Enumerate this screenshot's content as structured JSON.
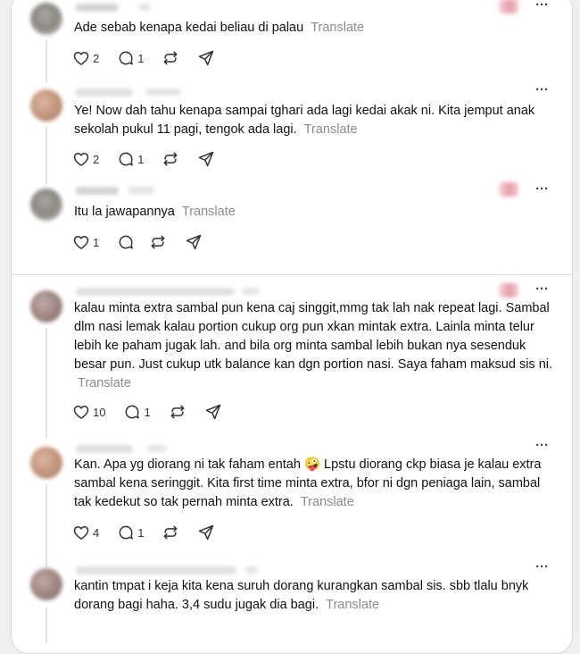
{
  "replies": [
    {
      "text": "Ade sebab kenapa kedai beliau di palau",
      "translate_label": "Translate",
      "likes": "2",
      "comments": "1"
    },
    {
      "text": "Ye! Now dah tahu kenapa sampai tghari ada lagi kedai akak ni. Kita jemput anak sekolah pukul 11 pagi, tengok ada lagi.",
      "translate_label": "Translate",
      "likes": "2",
      "comments": "1"
    },
    {
      "text": "Itu la jawapannya",
      "translate_label": "Translate",
      "likes": "1",
      "comments": ""
    },
    {
      "text": "kalau minta extra sambal pun kena caj singgit,mmg tak lah nak repeat lagi. Sambal dlm nasi lemak kalau portion cukup org pun xkan mintak extra. Lainla minta telur lebih ke paham jugak lah. and bila org minta sambal lebih bukan nya sesenduk besar pun. Just cukup utk balance kan dgn portion nasi. Saya faham maksud sis ni.",
      "translate_label": "Translate",
      "likes": "10",
      "comments": "1"
    },
    {
      "text": "Kan. Apa yg diorang ni tak faham entah 🤪 Lpstu diorang ckp biasa je kalau extra sambal kena seringgit. Kita first time minta extra, bfor ni dgn peniaga lain, sambal tak kedekut so tak pernah minta extra.",
      "translate_label": "Translate",
      "likes": "4",
      "comments": "1"
    },
    {
      "text": "kantin tmpat i keja kita kena suruh dorang kurangkan sambal sis. sbb tlalu bnyk dorang bagi haha. 3,4 sudu jugak dia bagi.",
      "translate_label": "Translate"
    }
  ],
  "icons": {
    "like": "heart-icon",
    "comment": "comment-icon",
    "repost": "repost-icon",
    "share": "share-icon",
    "more": "more-icon"
  },
  "colors": {
    "translate": "#8c8c8c",
    "text": "#111111",
    "divider": "#dcdcdc"
  }
}
